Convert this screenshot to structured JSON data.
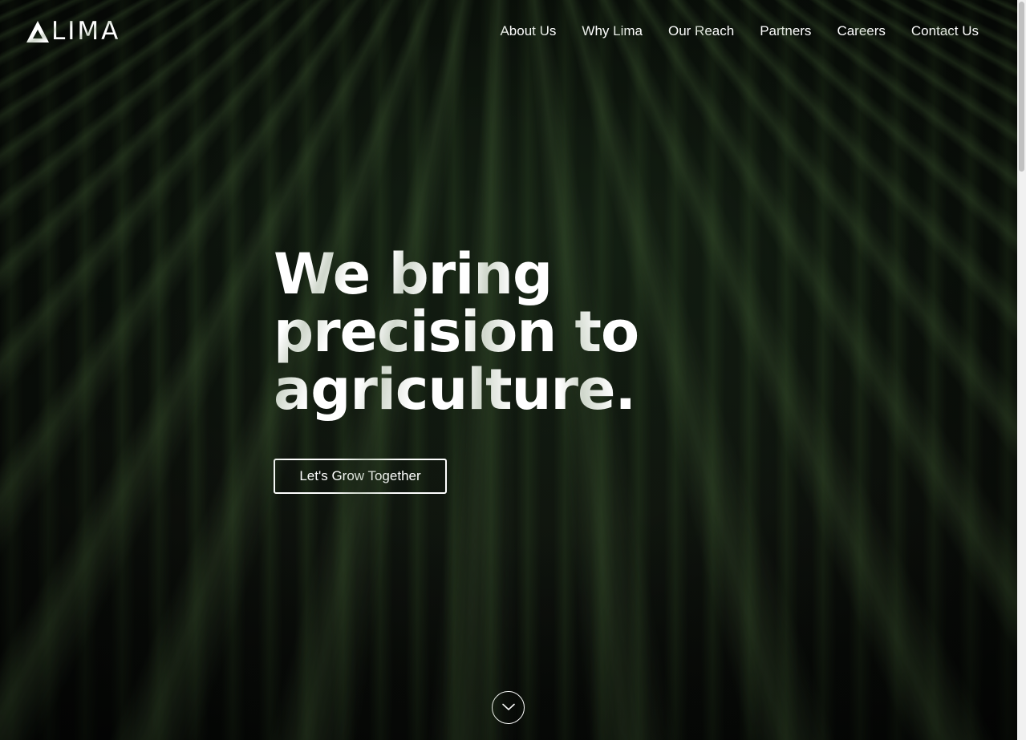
{
  "brand": {
    "logo_text": "LIMA",
    "logo_icon": "triangle-mountain-icon"
  },
  "nav": {
    "items": [
      {
        "label": "About Us"
      },
      {
        "label": "Why Lima"
      },
      {
        "label": "Our Reach"
      },
      {
        "label": "Partners"
      },
      {
        "label": "Careers"
      },
      {
        "label": "Contact Us"
      }
    ]
  },
  "hero": {
    "headline_line1": "We bring",
    "headline_line2": "precision to",
    "headline_line3": "agriculture.",
    "cta_label": "Let's Grow Together",
    "scroll_icon": "chevron-down-icon"
  },
  "colors": {
    "text": "#ffffff",
    "background": "#0e160e",
    "crop_green": "#344f28"
  }
}
